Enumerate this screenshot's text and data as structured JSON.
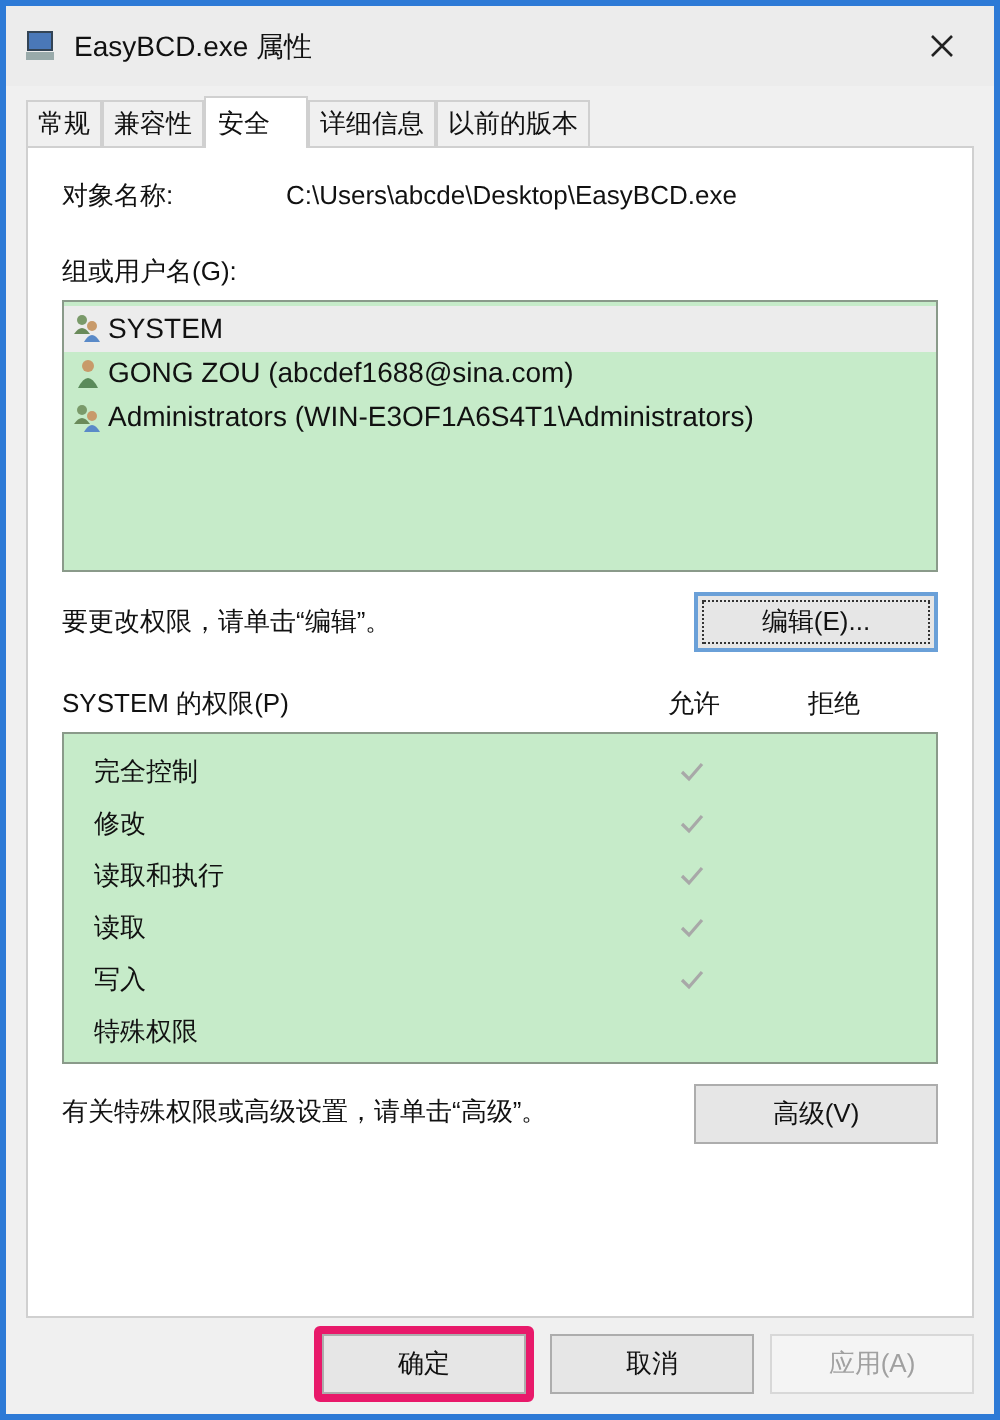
{
  "window": {
    "title": "EasyBCD.exe 属性"
  },
  "tabs": [
    {
      "label": "常规",
      "selected": false
    },
    {
      "label": "兼容性",
      "selected": false
    },
    {
      "label": "安全",
      "selected": true
    },
    {
      "label": "详细信息",
      "selected": false
    },
    {
      "label": "以前的版本",
      "selected": false
    }
  ],
  "object_name": {
    "label": "对象名称:",
    "value": "C:\\Users\\abcde\\Desktop\\EasyBCD.exe"
  },
  "users": {
    "label": "组或用户名(G):",
    "items": [
      {
        "name": "SYSTEM",
        "kind": "group",
        "selected": true
      },
      {
        "name": "GONG ZOU (abcdef1688@sina.com)",
        "kind": "user",
        "selected": false
      },
      {
        "name": "Administrators (WIN-E3OF1A6S4T1\\Administrators)",
        "kind": "group",
        "selected": false
      }
    ]
  },
  "edit_hint": "要更改权限，请单击“编辑”。",
  "edit_button": "编辑(E)...",
  "permissions": {
    "label": "SYSTEM 的权限(P)",
    "columns": [
      "允许",
      "拒绝"
    ],
    "rows": [
      {
        "name": "完全控制",
        "allow": true,
        "deny": false
      },
      {
        "name": "修改",
        "allow": true,
        "deny": false
      },
      {
        "name": "读取和执行",
        "allow": true,
        "deny": false
      },
      {
        "name": "读取",
        "allow": true,
        "deny": false
      },
      {
        "name": "写入",
        "allow": true,
        "deny": false
      },
      {
        "name": "特殊权限",
        "allow": false,
        "deny": false
      }
    ]
  },
  "advanced_hint": "有关特殊权限或高级设置，请单击“高级”。",
  "advanced_button": "高级(V)",
  "buttons": [
    {
      "label": "确定",
      "highlighted": true,
      "disabled": false
    },
    {
      "label": "取消",
      "highlighted": false,
      "disabled": false
    },
    {
      "label": "应用(A)",
      "highlighted": false,
      "disabled": true
    }
  ]
}
